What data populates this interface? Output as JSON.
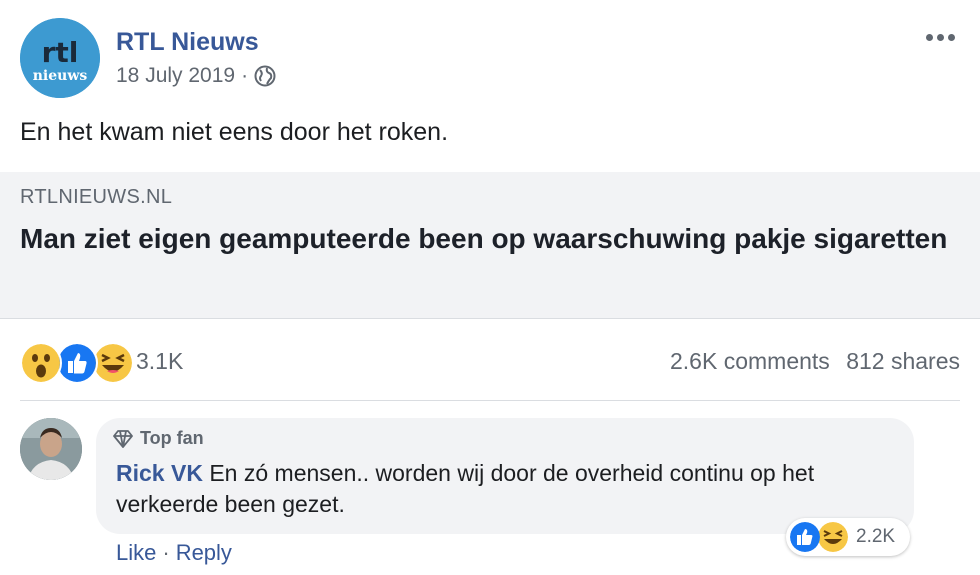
{
  "post": {
    "page_name": "RTL Nieuws",
    "date": "18 July 2019",
    "meta_separator": "·",
    "avatar_logo_top": "rtl",
    "avatar_logo_bottom": "nieuws",
    "text": "En het kwam niet eens door het roken."
  },
  "link": {
    "domain": "RTLNIEUWS.NL",
    "title": "Man ziet eigen geamputeerde been op waarschuwing pakje sigaretten"
  },
  "reactions": {
    "icons": [
      "wow-icon",
      "like-icon",
      "haha-icon"
    ],
    "count": "3.1K",
    "comments": "2.6K comments",
    "shares": "812 shares"
  },
  "comment": {
    "badge": "Top fan",
    "author": "Rick VK",
    "text": "En zó mensen.. worden wij door de overheid continu op het verkeerde been gezet.",
    "reaction_icons": [
      "like-icon",
      "haha-icon"
    ],
    "reaction_count": "2.2K",
    "actions": {
      "like": "Like",
      "separator": "·",
      "reply": "Reply"
    }
  },
  "colors": {
    "link_blue": "#385898",
    "meta_gray": "#606770",
    "card_bg": "#f2f3f5",
    "like_blue": "#1877f2",
    "emoji_yellow": "#f7c745"
  }
}
